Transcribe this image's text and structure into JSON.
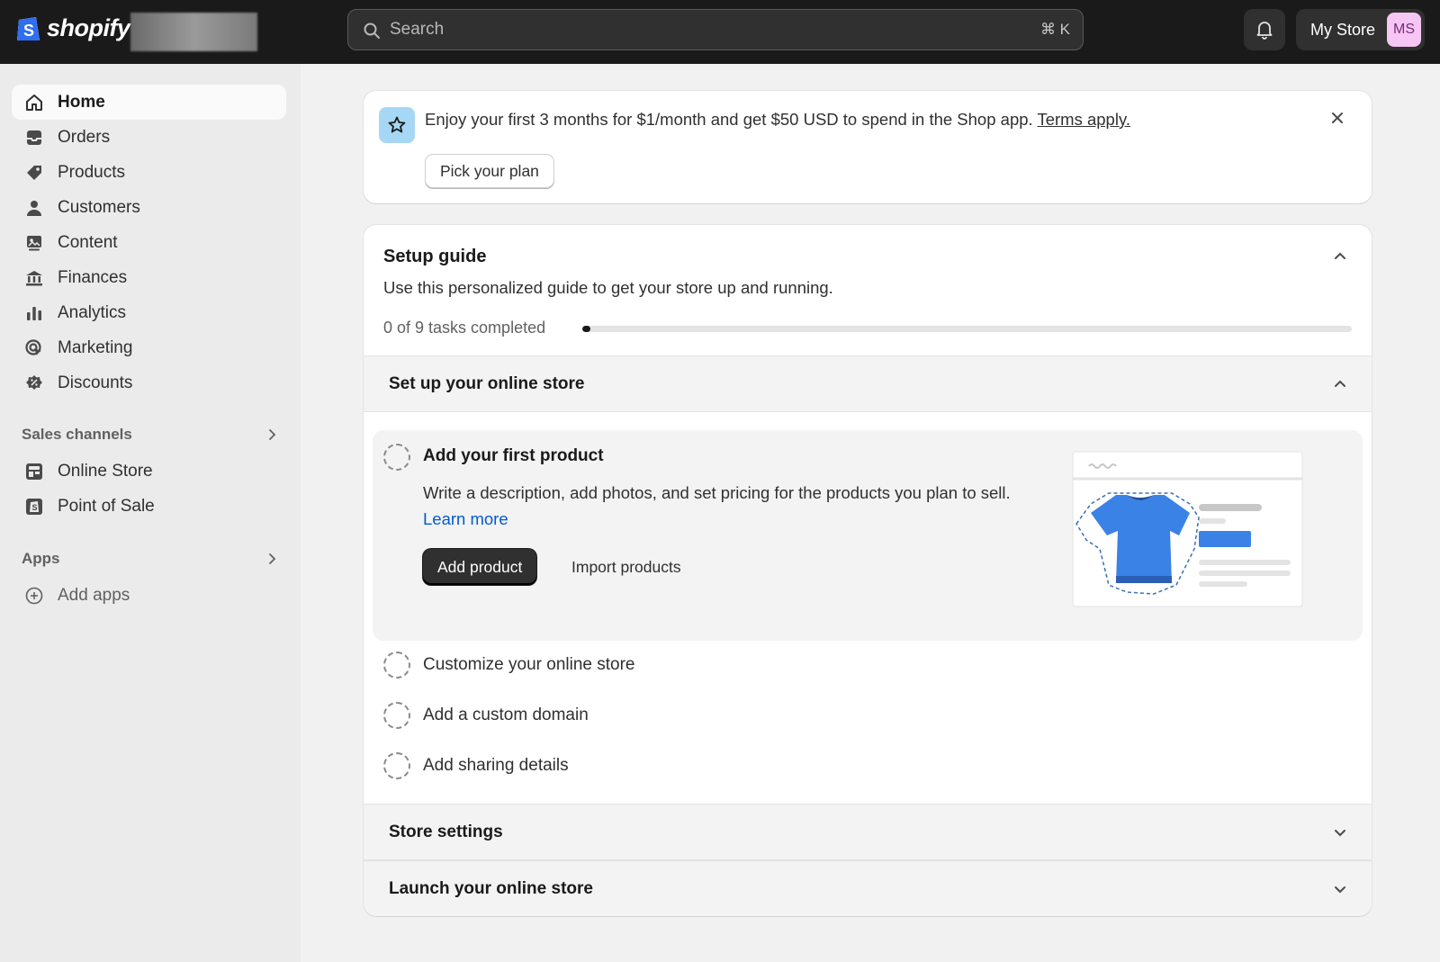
{
  "topbar": {
    "logo_text": "shopify",
    "search_placeholder": "Search",
    "search_shortcut": "⌘ K",
    "store_name": "My Store",
    "avatar_initials": "MS"
  },
  "sidebar": {
    "items": [
      {
        "label": "Home",
        "icon": "home-icon"
      },
      {
        "label": "Orders",
        "icon": "inbox-icon"
      },
      {
        "label": "Products",
        "icon": "tag-icon"
      },
      {
        "label": "Customers",
        "icon": "person-icon"
      },
      {
        "label": "Content",
        "icon": "image-icon"
      },
      {
        "label": "Finances",
        "icon": "bank-icon"
      },
      {
        "label": "Analytics",
        "icon": "bar-chart-icon"
      },
      {
        "label": "Marketing",
        "icon": "target-icon"
      },
      {
        "label": "Discounts",
        "icon": "discount-icon"
      }
    ],
    "sales_channels_label": "Sales channels",
    "channels": [
      {
        "label": "Online Store",
        "icon": "store-icon"
      },
      {
        "label": "Point of Sale",
        "icon": "pos-icon"
      }
    ],
    "apps_label": "Apps",
    "add_apps_label": "Add apps"
  },
  "banner": {
    "text": "Enjoy your first 3 months for $1/month and get $50 USD to spend in the Shop app.",
    "link": "Terms apply.",
    "button": "Pick your plan"
  },
  "guide": {
    "title": "Setup guide",
    "subtitle": "Use this personalized guide to get your store up and running.",
    "progress_text": "0 of 9 tasks completed",
    "progress_fraction": 0.01,
    "section_online_store": "Set up your online store",
    "active_task": {
      "title": "Add your first product",
      "description": "Write a description, add photos, and set pricing for the products you plan to sell.",
      "link": "Learn more",
      "primary_button": "Add product",
      "secondary_button": "Import products"
    },
    "tasks": [
      "Customize your online store",
      "Add a custom domain",
      "Add sharing details"
    ],
    "section_store_settings": "Store settings",
    "section_launch": "Launch your online store"
  },
  "colors": {
    "accent_link": "#005bd3",
    "topbar_bg": "#1a1a1a",
    "illustration_blue": "#3b82e6"
  }
}
